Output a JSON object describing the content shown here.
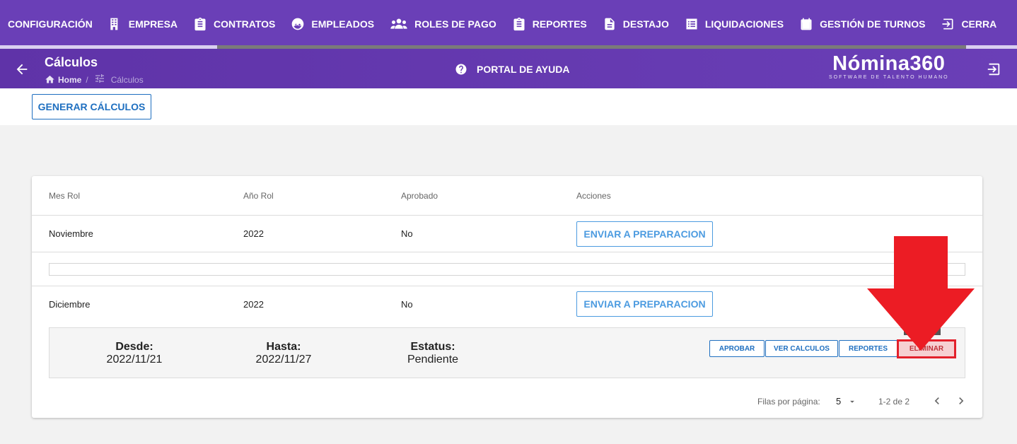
{
  "topnav": {
    "items": [
      {
        "label": "CONFIGURACIÓN",
        "icon": "none"
      },
      {
        "label": "EMPRESA",
        "icon": "building-icon"
      },
      {
        "label": "CONTRATOS",
        "icon": "clipboard-icon"
      },
      {
        "label": "EMPLEADOS",
        "icon": "face-icon"
      },
      {
        "label": "ROLES DE PAGO",
        "icon": "group-icon"
      },
      {
        "label": "REPORTES",
        "icon": "clipboard-icon"
      },
      {
        "label": "DESTAJO",
        "icon": "document-icon"
      },
      {
        "label": "LIQUIDACIONES",
        "icon": "list-icon"
      },
      {
        "label": "GESTIÓN DE TURNOS",
        "icon": "calendar-icon"
      },
      {
        "label": "CERRA",
        "icon": "logout-icon"
      }
    ]
  },
  "header": {
    "title": "Cálculos",
    "breadcrumb": {
      "home": "Home",
      "separator": "/",
      "current": "Cálculos"
    },
    "help": "PORTAL DE AYUDA",
    "logo": {
      "brand": "Nómina360",
      "tagline": "SOFTWARE DE TALENTO HUMANO"
    }
  },
  "actions": {
    "generate": "GENERAR CÁLCULOS"
  },
  "table": {
    "columns": [
      "Mes Rol",
      "Año Rol",
      "Aprobado",
      "Acciones"
    ],
    "rows": [
      {
        "mes": "Noviembre",
        "anio": "2022",
        "aprobado": "No",
        "action": "ENVIAR A PREPARACION"
      },
      {
        "mes": "Diciembre",
        "anio": "2022",
        "aprobado": "No",
        "action": "ENVIAR A PREPARACION"
      }
    ],
    "detail": {
      "desde_label": "Desde:",
      "desde": "2022/11/21",
      "hasta_label": "Hasta:",
      "hasta": "2022/11/27",
      "estatus_label": "Estatus:",
      "estatus": "Pendiente",
      "buttons": {
        "aprobar": "APROBAR",
        "ver": "VER CALCULOS",
        "reportes": "REPORTES",
        "eliminar": "ELIMINAR"
      }
    },
    "pagination": {
      "rows_label": "Filas por página:",
      "rows_per_page": "5",
      "range": "1-2 de 2"
    }
  },
  "colors": {
    "primary": "#6a3fb7",
    "accent": "#1e6fc0",
    "highlight": "#e3202b"
  }
}
